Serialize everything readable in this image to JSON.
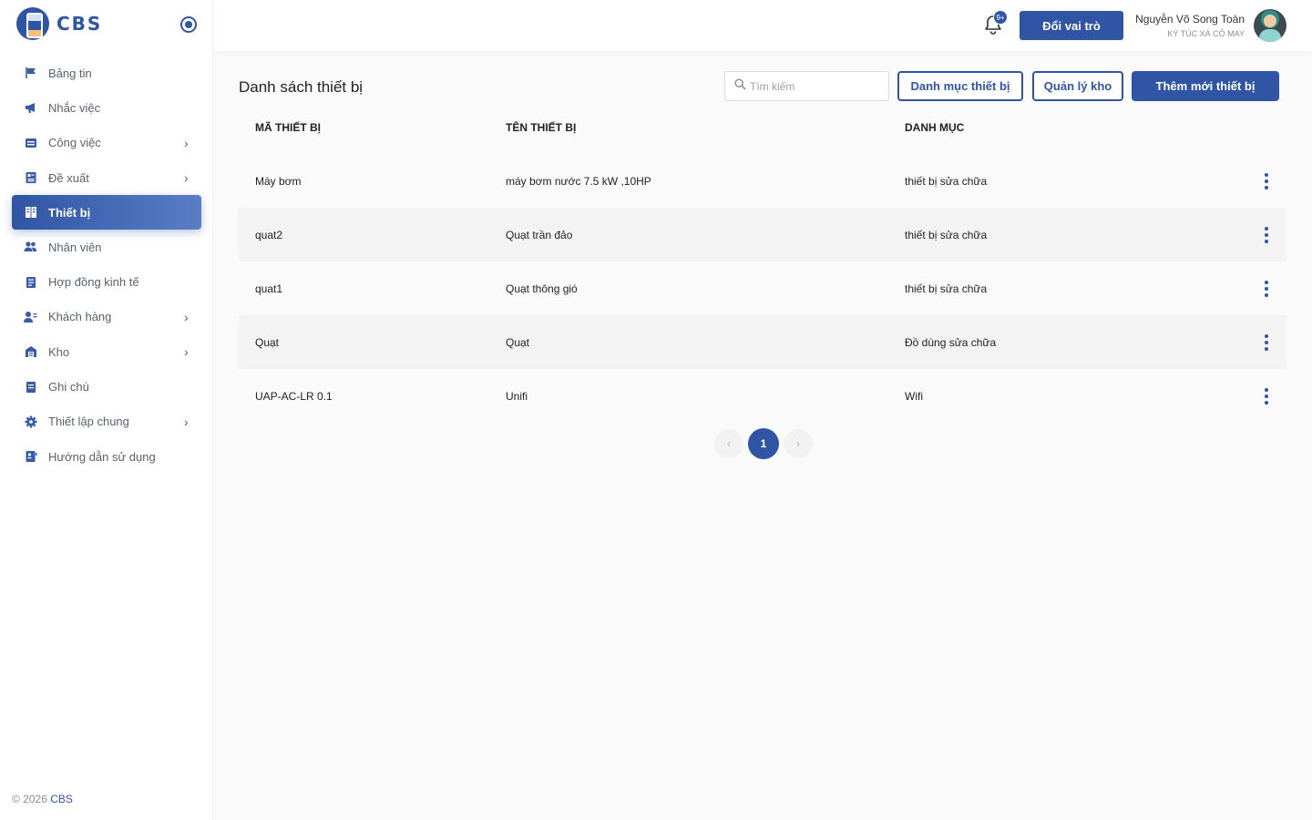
{
  "app": {
    "name": "CBS"
  },
  "sidebar": {
    "items": [
      {
        "label": "Bảng tin",
        "icon": "flag-icon",
        "has_submenu": false,
        "active": false
      },
      {
        "label": "Nhắc việc",
        "icon": "megaphone-icon",
        "has_submenu": false,
        "active": false
      },
      {
        "label": "Công việc",
        "icon": "tasks-icon",
        "has_submenu": true,
        "active": false
      },
      {
        "label": "Đề xuất",
        "icon": "proposal-icon",
        "has_submenu": true,
        "active": false
      },
      {
        "label": "Thiết bị",
        "icon": "device-icon",
        "has_submenu": false,
        "active": true
      },
      {
        "label": "Nhân viên",
        "icon": "users-icon",
        "has_submenu": false,
        "active": false
      },
      {
        "label": "Hợp đồng kinh tế",
        "icon": "contract-icon",
        "has_submenu": false,
        "active": false
      },
      {
        "label": "Khách hàng",
        "icon": "customer-icon",
        "has_submenu": true,
        "active": false
      },
      {
        "label": "Kho",
        "icon": "warehouse-icon",
        "has_submenu": true,
        "active": false
      },
      {
        "label": "Ghi chú",
        "icon": "note-icon",
        "has_submenu": false,
        "active": false
      },
      {
        "label": "Thiết lập chung",
        "icon": "gear-icon",
        "has_submenu": true,
        "active": false
      },
      {
        "label": "Hướng dẫn sử dụng",
        "icon": "guide-icon",
        "has_submenu": false,
        "active": false
      }
    ],
    "copyright_prefix": "© 2026",
    "copyright_brand": "CBS"
  },
  "header": {
    "notification_badge": "9+",
    "switch_role_label": "Đổi vai trò",
    "user_name": "Nguyễn Võ Song Toàn",
    "user_org": "KÝ TÚC XÁ CỎ MAY"
  },
  "main": {
    "title": "Danh sách thiết bị",
    "search_placeholder": "Tìm kiếm",
    "buttons": {
      "category": "Danh mục thiết bị",
      "warehouse": "Quản lý kho",
      "add_new": "Thêm mới thiết bị"
    },
    "table": {
      "columns": [
        "MÃ THIẾT BỊ",
        "TÊN THIẾT BỊ",
        "DANH MỤC"
      ],
      "rows": [
        [
          "Máy bơm",
          "máy bơm nước 7.5 kW ,10HP",
          "thiết bị sửa chữa"
        ],
        [
          "quat2",
          "Quạt trần đảo",
          "thiết bị sửa chữa"
        ],
        [
          "quat1",
          "Quạt thông gió",
          "thiết bị sửa chữa"
        ],
        [
          "Quạt",
          "Quạt",
          "Đồ dùng sửa chữa"
        ],
        [
          "UAP-AC-LR 0.1",
          "Unifi",
          "Wifi"
        ]
      ]
    },
    "pagination": {
      "current_page": "1",
      "prev": "‹",
      "next": "›"
    }
  },
  "colors": {
    "primary": "#2f55a4",
    "row_alt": "#f3f3f3"
  }
}
